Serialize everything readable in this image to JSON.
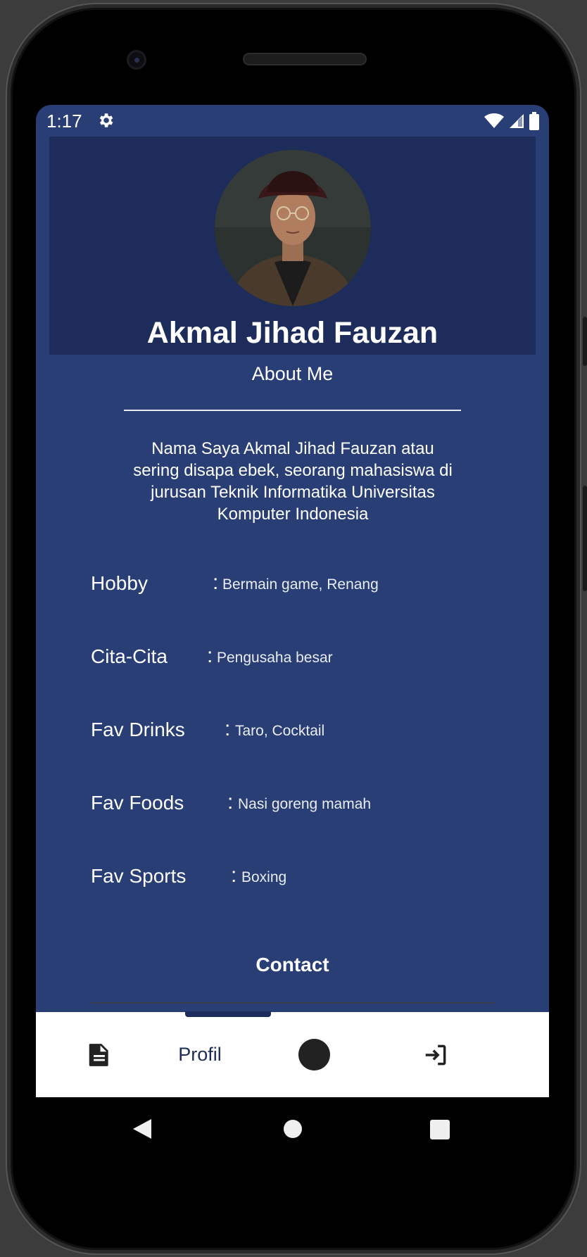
{
  "status_bar": {
    "time": "1:17",
    "settings_icon": "gear-icon",
    "wifi_icon": "wifi-icon",
    "signal_icon": "signal-icon",
    "battery_icon": "battery-icon"
  },
  "profile": {
    "name": "Akmal Jihad Fauzan",
    "about_title": "About Me",
    "about_text": "Nama Saya Akmal Jihad Fauzan atau sering disapa ebek, seorang mahasiswa di jurusan Teknik Informatika Universitas Komputer Indonesia"
  },
  "info": [
    {
      "label": "Hobby",
      "colon": ":",
      "value": "Bermain game, Renang"
    },
    {
      "label": "Cita-Cita",
      "colon": ":",
      "value": "Pengusaha besar"
    },
    {
      "label": "Fav Drinks",
      "colon": ":",
      "value": "Taro, Cocktail"
    },
    {
      "label": "Fav Foods",
      "colon": ":",
      "value": "Nasi goreng mamah"
    },
    {
      "label": "Fav Sports",
      "colon": ":",
      "value": "Boxing"
    }
  ],
  "contact": {
    "title": "Contact"
  },
  "bottom_nav": {
    "items": [
      {
        "icon": "document-icon"
      },
      {
        "label": "Profil"
      },
      {
        "icon": "circle-icon"
      },
      {
        "icon": "logout-icon"
      }
    ]
  },
  "colors": {
    "background": "#283e74",
    "header": "#1d2c5a",
    "nav_background": "#ffffff",
    "nav_text": "#1d2c5a"
  }
}
